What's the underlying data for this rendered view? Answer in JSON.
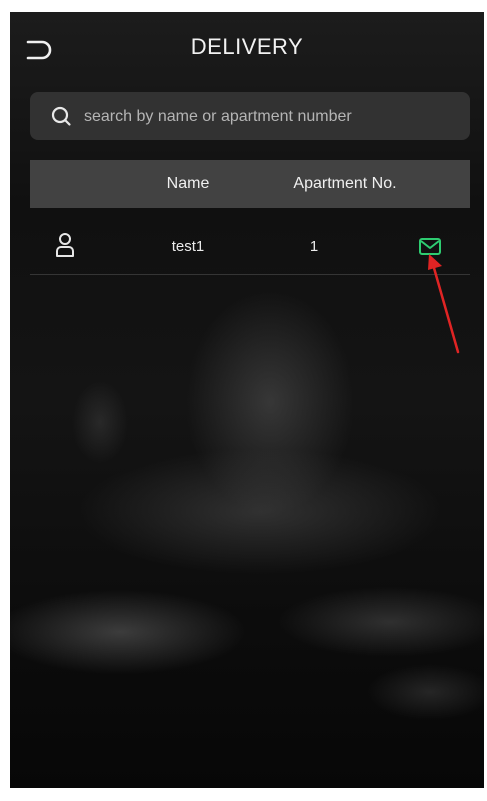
{
  "header": {
    "title": "DELIVERY",
    "back_icon": "back-arrow-icon"
  },
  "search": {
    "placeholder": "search by name or apartment number",
    "value": "",
    "icon": "search-icon"
  },
  "table": {
    "columns": {
      "name": "Name",
      "apartment": "Apartment No."
    },
    "rows": [
      {
        "name": "test1",
        "apartment": "1",
        "icon": "user-icon",
        "action_icon": "mail-icon"
      }
    ]
  },
  "colors": {
    "accent_mail": "#2ecc71",
    "annotation_arrow": "#e02424",
    "text": "#f2f2f2",
    "panel": "#3c3c3c"
  }
}
